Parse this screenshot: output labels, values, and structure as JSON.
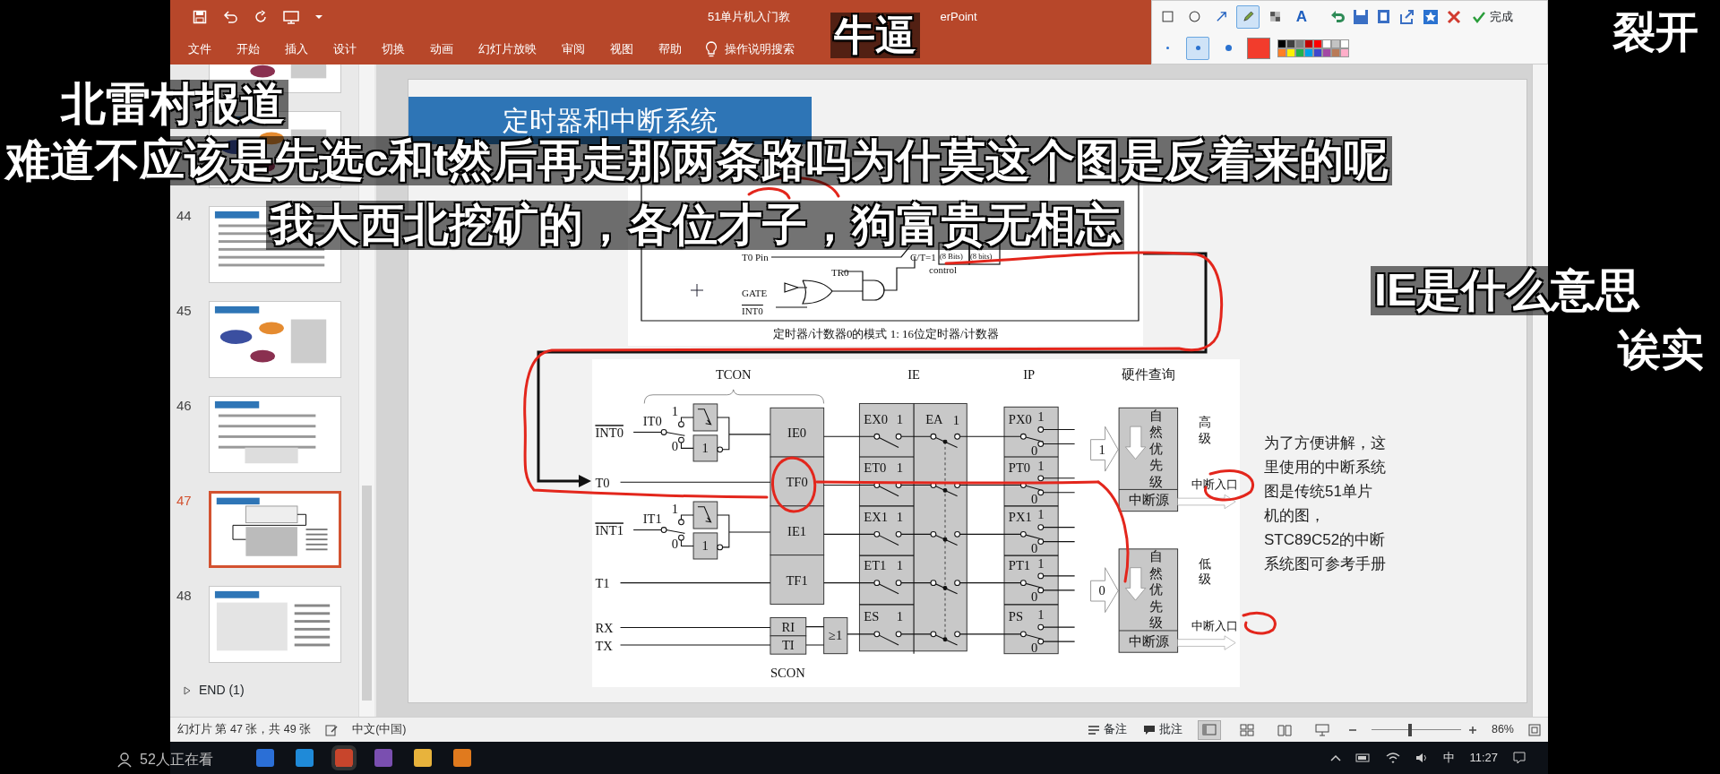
{
  "window": {
    "title_left": "51单片机入门教",
    "title_right": "erPoint"
  },
  "ribbon": {
    "tabs": [
      {
        "label": "文件"
      },
      {
        "label": "开始"
      },
      {
        "label": "插入"
      },
      {
        "label": "设计"
      },
      {
        "label": "切换"
      },
      {
        "label": "动画"
      },
      {
        "label": "幻灯片放映"
      },
      {
        "label": "审阅"
      },
      {
        "label": "视图"
      },
      {
        "label": "帮助"
      }
    ],
    "tell_me": "操作说明搜索"
  },
  "annotation_toolbar": {
    "tools": [
      {
        "kind": "rect",
        "selected": false
      },
      {
        "kind": "ellipse",
        "selected": false
      },
      {
        "kind": "arrow",
        "selected": false
      },
      {
        "kind": "pen",
        "selected": true
      },
      {
        "kind": "mosaic",
        "selected": false
      },
      {
        "kind": "text",
        "glyph": "A",
        "selected": false
      }
    ],
    "actions": [
      {
        "kind": "undo"
      },
      {
        "kind": "save"
      },
      {
        "kind": "copy"
      },
      {
        "kind": "share"
      },
      {
        "kind": "pin"
      },
      {
        "kind": "close"
      }
    ],
    "done": "完成",
    "sizes": [
      {
        "selected": false
      },
      {
        "selected": true
      },
      {
        "selected": false
      }
    ],
    "current_swatch": {
      "color": "#f23c2c"
    },
    "palette": [
      {
        "color": "#000000"
      },
      {
        "color": "#404040"
      },
      {
        "color": "#7f7f7f"
      },
      {
        "color": "#c00000"
      },
      {
        "color": "#ff0000"
      },
      {
        "color": "#ffffff"
      },
      {
        "color": "#c3c3c3"
      },
      {
        "color": "#ffffff"
      },
      {
        "color": "#ff7f27"
      },
      {
        "color": "#fff200"
      },
      {
        "color": "#22b14c"
      },
      {
        "color": "#00a2e8"
      },
      {
        "color": "#3f48cc"
      },
      {
        "color": "#a349a4"
      },
      {
        "color": "#b97a57"
      },
      {
        "color": "#ffaec9"
      }
    ]
  },
  "thumbnails": [
    {
      "kind": "diagram",
      "selected": false
    },
    {
      "kind": "diagram",
      "selected": false
    },
    {
      "number": "44",
      "kind": "text",
      "selected": false
    },
    {
      "number": "45",
      "kind": "diagram",
      "selected": false
    },
    {
      "number": "46",
      "kind": "list",
      "selected": false
    },
    {
      "number": "47",
      "kind": "circuit",
      "selected": true
    },
    {
      "number": "48",
      "kind": "table",
      "selected": false
    }
  ],
  "sections": [
    {
      "label": "END (1)",
      "expanded": false
    }
  ],
  "slide": {
    "title": "定时器和中断系统",
    "timer_diagram": {
      "t0_pin": "T0 Pin",
      "ct": "C/T=1",
      "tr0": "TR0",
      "gate": "GATE",
      "int0": "INT0",
      "control": "control",
      "tl0": "(8 Bits)",
      "th0": "(8 bits)",
      "caption": "定时器/计数器0的模式 1: 16位定时器/计数器"
    },
    "interrupt_diagram": {
      "headers": {
        "tcon": "TCON",
        "ie": "IE",
        "ip": "IP",
        "query": "硬件查询",
        "scon": "SCON"
      },
      "inputs": [
        {
          "label": "INT0",
          "overline": true
        },
        {
          "label": "T0",
          "overline": false
        },
        {
          "label": "INT1",
          "overline": true
        },
        {
          "label": "T1",
          "overline": false
        },
        {
          "label": "RX",
          "overline": false
        },
        {
          "label": "TX",
          "overline": false
        }
      ],
      "triggers": [
        {
          "label": "IT0",
          "on": "1",
          "off": "0",
          "inverter": "1"
        },
        {
          "label": "IT1",
          "on": "1",
          "off": "0",
          "inverter": "1"
        }
      ],
      "flags": [
        "IE0",
        "TF0",
        "IE1",
        "TF1"
      ],
      "serial_flags": [
        "RI",
        "TI"
      ],
      "or_gate": "≥1",
      "enable_bits": [
        {
          "label": "EX0",
          "on": "1"
        },
        {
          "label": "ET0",
          "on": "1"
        },
        {
          "label": "EX1",
          "on": "1"
        },
        {
          "label": "ET1",
          "on": "1"
        },
        {
          "label": "ES",
          "on": "1"
        }
      ],
      "global_enable": {
        "label": "EA",
        "on": "1"
      },
      "priority_bits": [
        {
          "label": "PX0",
          "on": "1",
          "off": "0"
        },
        {
          "label": "PT0",
          "on": "1",
          "off": "0"
        },
        {
          "label": "PX1",
          "on": "1",
          "off": "0"
        },
        {
          "label": "PT1",
          "on": "1",
          "off": "0"
        },
        {
          "label": "PS",
          "on": "1",
          "off": "0"
        }
      ],
      "levels": [
        {
          "group": "高级",
          "arrow": "1",
          "stack": "自然优先级",
          "source": "中断源",
          "exit": "中断入口"
        },
        {
          "group": "低级",
          "arrow": "0",
          "stack": "自然优先级",
          "source": "中断源",
          "exit": "中断入口"
        }
      ]
    },
    "note": "为了方便讲解，这里使用的中断系统图是传统51单片机的图，STC89C52的中断系统图可参考手册"
  },
  "status_bar": {
    "slide_info": "幻灯片 第 47 张，共 49 张",
    "language": "中文(中国)",
    "notes": "备注",
    "comments": "批注",
    "views": [
      {
        "kind": "normal",
        "selected": true
      },
      {
        "kind": "sorter",
        "selected": false
      },
      {
        "kind": "reading",
        "selected": false
      },
      {
        "kind": "show",
        "selected": false
      }
    ],
    "zoom": {
      "level": 0.43,
      "reading": "86%"
    }
  },
  "taskbar": {
    "viewer_count": "52人正在看",
    "apps": [
      {
        "color": "#2b6fd6",
        "selected": false
      },
      {
        "color": "#1f8ad8",
        "selected": false
      },
      {
        "color": "#c8452c",
        "selected": true
      },
      {
        "color": "#7a4fb0",
        "selected": false
      },
      {
        "color": "#e8b33c",
        "selected": false
      },
      {
        "color": "#e07a1e",
        "selected": false
      }
    ],
    "ime": "中",
    "time": "11:27"
  },
  "danmaku": [
    {
      "text": "牛逼"
    },
    {
      "text": "裂开"
    },
    {
      "text": "北雷村报道"
    },
    {
      "text": "难道不应该是先选c和t然后再走那两条路吗为什莫这个图是反着来的呢"
    },
    {
      "text": "我大西北挖矿的，各位才子，狗富贵无相忘"
    },
    {
      "text": "IE是什么意思"
    },
    {
      "text": "诶实"
    }
  ]
}
